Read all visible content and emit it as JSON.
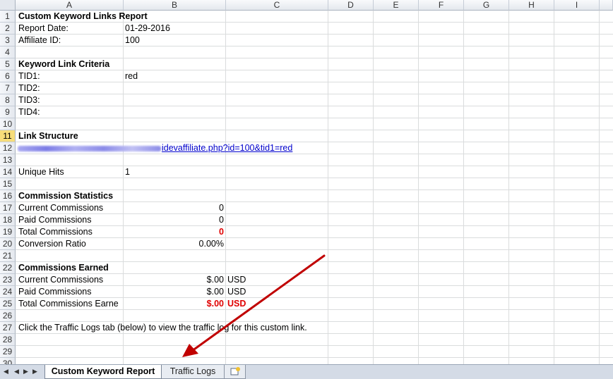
{
  "columns": [
    "A",
    "B",
    "C",
    "D",
    "E",
    "F",
    "G",
    "H",
    "I"
  ],
  "rows": [
    "1",
    "2",
    "3",
    "4",
    "5",
    "6",
    "7",
    "8",
    "9",
    "10",
    "11",
    "12",
    "13",
    "14",
    "15",
    "16",
    "17",
    "18",
    "19",
    "20",
    "21",
    "22",
    "23",
    "24",
    "25",
    "26",
    "27",
    "28",
    "29",
    "30"
  ],
  "selected_row": "11",
  "report": {
    "title": "Custom Keyword Links Report",
    "report_date_label": "Report Date:",
    "report_date_value": "01-29-2016",
    "affiliate_id_label": "Affiliate ID:",
    "affiliate_id_value": "100",
    "criteria_heading": "Keyword Link Criteria",
    "tid1_label": "TID1:",
    "tid1_value": "red",
    "tid2_label": "TID2:",
    "tid3_label": "TID3:",
    "tid4_label": "TID4:",
    "link_heading": "Link Structure",
    "link_visible_text": "idevaffiliate.php?id=100&tid1=red",
    "unique_hits_label": "Unique Hits",
    "unique_hits_value": "1",
    "commission_stats_heading": "Commission Statistics",
    "current_commissions_label": "Current Commissions",
    "current_commissions_value": "0",
    "paid_commissions_label": "Paid Commissions",
    "paid_commissions_value": "0",
    "total_commissions_label": "Total Commissions",
    "total_commissions_value": "0",
    "conversion_ratio_label": "Conversion Ratio",
    "conversion_ratio_value": "0.00%",
    "earned_heading": "Commissions Earned",
    "earned_current_label": "Current Commissions",
    "earned_current_value": "$.00",
    "earned_current_currency": "USD",
    "earned_paid_label": "Paid Commissions",
    "earned_paid_value": "$.00",
    "earned_paid_currency": "USD",
    "earned_total_label": "Total Commissions Earne",
    "earned_total_value": "$.00",
    "earned_total_currency": "USD",
    "note": "Click the Traffic Logs tab (below) to view the traffic log for this custom link."
  },
  "tabs": {
    "active": "Custom Keyword Report",
    "second": "Traffic Logs"
  },
  "colors": {
    "accent_red": "#e00000",
    "link_blue": "#0000cc",
    "arrow": "#c00000",
    "selected_row_header": "#f7dd7a"
  }
}
